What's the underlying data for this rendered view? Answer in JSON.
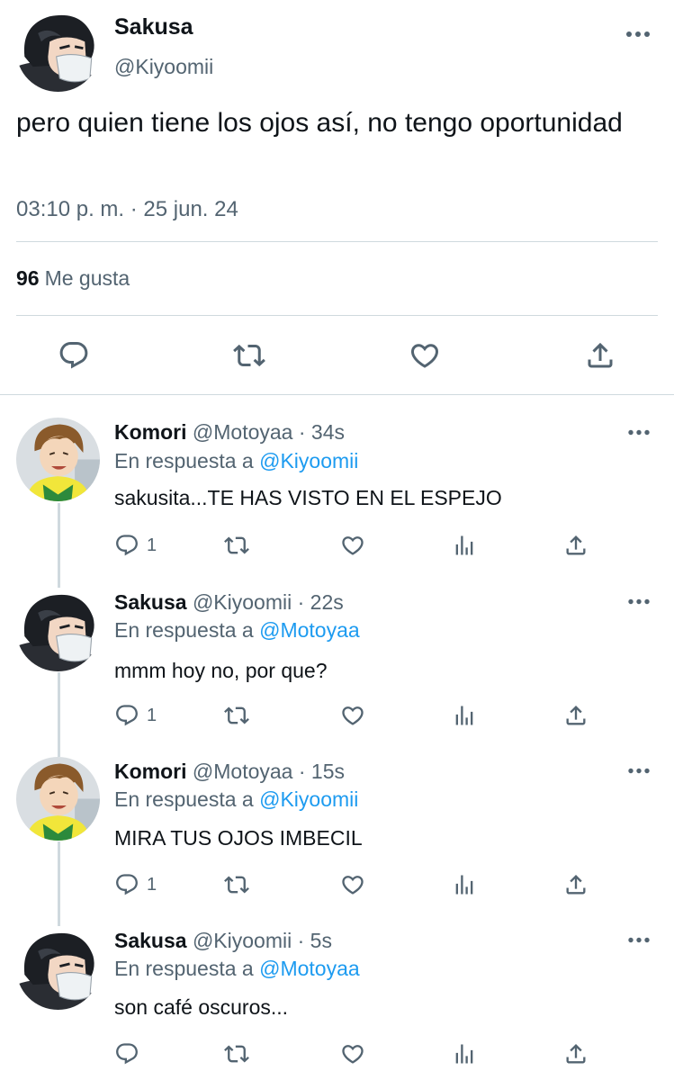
{
  "main_tweet": {
    "name": "Sakusa",
    "handle": "@Kiyoomii",
    "text": "pero quien tiene los ojos así, no tengo oportunidad",
    "timestamp": "03:10 p. m. · 25 jun. 24",
    "likes_count": "96",
    "likes_label": "Me gusta",
    "actions": [
      "reply-icon",
      "retweet-icon",
      "like-icon",
      "share-icon"
    ]
  },
  "replies": [
    {
      "name": "Komori",
      "handle": "@Motoyaa",
      "time": "· 34s",
      "reply_prefix": "En respuesta a",
      "reply_to": "@Kiyoomii",
      "text": "sakusita...TE HAS VISTO EN EL ESPEJO",
      "reply_count": "1"
    },
    {
      "name": "Sakusa",
      "handle": "@Kiyoomii",
      "time": "· 22s",
      "reply_prefix": "En respuesta a",
      "reply_to": "@Motoyaa",
      "text": "mmm hoy no, por que?",
      "reply_count": "1"
    },
    {
      "name": "Komori",
      "handle": "@Motoyaa",
      "time": "· 15s",
      "reply_prefix": "En respuesta a",
      "reply_to": "@Kiyoomii",
      "text": "MIRA TUS OJOS IMBECIL",
      "reply_count": "1"
    },
    {
      "name": "Sakusa",
      "handle": "@Kiyoomii",
      "time": "· 5s",
      "reply_prefix": "En respuesta a",
      "reply_to": "@Motoyaa",
      "text": "son café oscuros...",
      "reply_count": ""
    }
  ],
  "colors": {
    "text": "#0f1419",
    "secondary": "#536471",
    "accent": "#1d9bf0",
    "divider": "#cfd9de"
  }
}
